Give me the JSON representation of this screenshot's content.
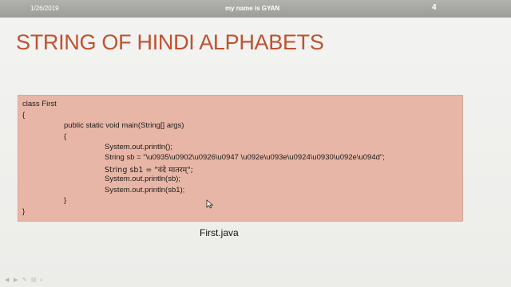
{
  "header": {
    "date": "1/26/2019",
    "footer_text": "my name is GYAN",
    "slide_number": "4"
  },
  "slide": {
    "title": "STRING OF HINDI ALPHABETS",
    "code_lines": [
      "class First",
      "{",
      "public static void main(String[] args)",
      "{",
      "System.out.println();",
      "String sb = \"\\u0935\\u0902\\u0926\\u0947  \\u092e\\u093e\\u0924\\u0930\\u092e\\u094d\";",
      "String sb1 = \"वंदे मातरम्\";",
      "System.out.println(sb);",
      "System.out.println(sb1);",
      "}",
      "}"
    ],
    "caption": "First.java"
  },
  "controls": {
    "icons": [
      "prev-icon",
      "next-icon",
      "pen-icon",
      "menu-icon",
      "zoom-icon"
    ]
  }
}
